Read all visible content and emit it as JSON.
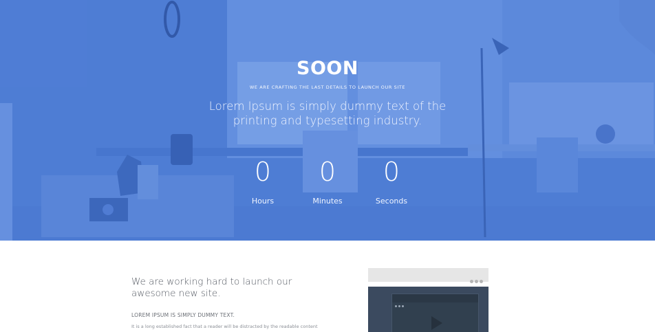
{
  "hero": {
    "brand": "SOON",
    "tagline": "WE ARE CRAFTING THE LAST DETAILS TO LAUNCH OUR SITE",
    "lead": "Lorem Ipsum is simply dummy text of the printing and typesetting industry."
  },
  "countdown": [
    {
      "value": "0",
      "label": "Hours"
    },
    {
      "value": "0",
      "label": "Minutes"
    },
    {
      "value": "0",
      "label": "Seconds"
    }
  ],
  "about": {
    "title": "We are working hard to launch our awesome new site.",
    "subtitle": "LOREM IPSUM IS SIMPLY DUMMY TEXT.",
    "text": "It is a long established fact that a reader will be distracted by the readable content"
  },
  "colors": {
    "hero_overlay": "#3a6cd2",
    "mock_screen": "#3b4a5f"
  },
  "icons": {
    "play": "play-icon"
  }
}
